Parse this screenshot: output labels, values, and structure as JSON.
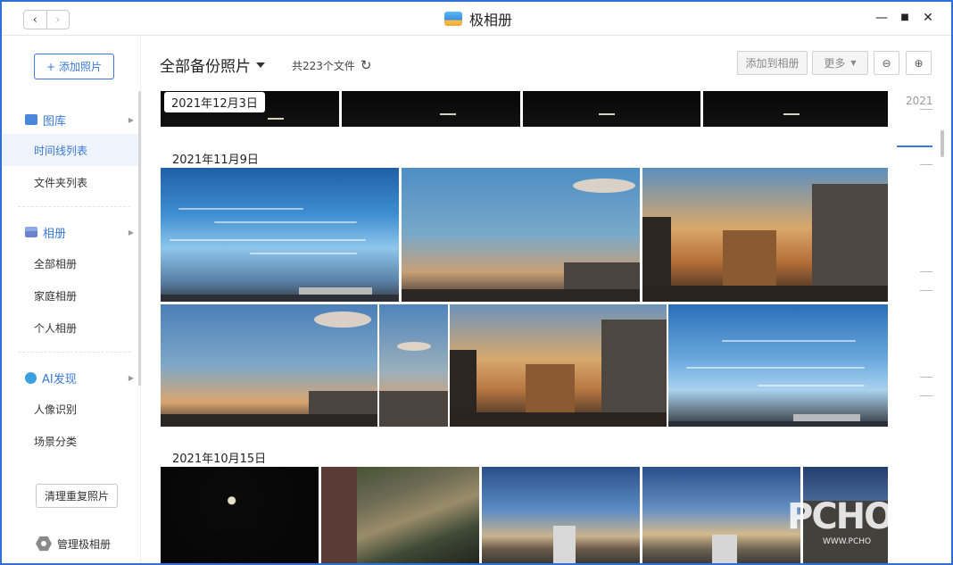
{
  "titlebar": {
    "title": "极相册",
    "back_icon": "‹",
    "forward_icon": "›",
    "minimize_icon": "—",
    "maximize_icon": "■",
    "close_icon": "✕"
  },
  "sidebar": {
    "add_label": "添加照片",
    "add_icon": "+",
    "groups": [
      {
        "label": "图库",
        "items": [
          "时间线列表",
          "文件夹列表"
        ]
      },
      {
        "label": "相册",
        "items": [
          "全部相册",
          "家庭相册",
          "个人相册"
        ]
      },
      {
        "label": "AI发现",
        "items": [
          "人像识别",
          "场景分类"
        ]
      }
    ],
    "clean_label": "清理重复照片",
    "manage_label": "管理极相册"
  },
  "toolbar": {
    "crumb": "全部备份照片",
    "count": "共223个文件",
    "refresh_icon": "↻",
    "add_to_album": "添加到相册",
    "more": "更多",
    "zoom_out_icon": "⊖",
    "zoom_in_icon": "⊕"
  },
  "content": {
    "sections": [
      {
        "date": "2021年12月3日"
      },
      {
        "date": "2021年11月9日"
      },
      {
        "date": "2021年10月15日"
      }
    ]
  },
  "timeline": {
    "year": "2021"
  },
  "watermark": {
    "text": "PCHO",
    "url": "WWW.PCHO"
  }
}
